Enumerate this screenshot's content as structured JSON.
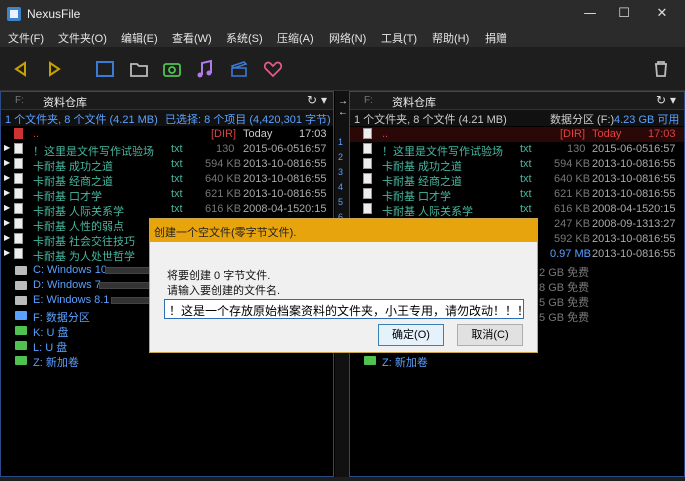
{
  "window": {
    "title": "NexusFile",
    "minimize": "—",
    "maximize": "☐",
    "close": "✕"
  },
  "menu": [
    "文件(F)",
    "文件夹(O)",
    "编辑(E)",
    "查看(W)",
    "系统(S)",
    "压缩(A)",
    "网络(N)",
    "工具(T)",
    "帮助(H)",
    "捐赠"
  ],
  "toolbar": {
    "icons": [
      "arrow-left-icon",
      "arrow-right-icon",
      "panel-icon",
      "folder-icon",
      "camera-icon",
      "music-icon",
      "box-icon",
      "heart-icon",
      "trash-icon"
    ],
    "colors": {
      "accent_yellow": "#c8a000",
      "blue": "#3a7ad8",
      "green": "#4fc24f",
      "purple": "#b07ae8",
      "pink": "#e05a8a"
    }
  },
  "left_panel": {
    "drive": "F:",
    "path": "资料仓库",
    "info_left": "1 个文件夹, 8 个文件 (4.21 MB)",
    "info_right": "已选择: 8 个项目 (4,420,301 字节)",
    "rows": [
      {
        "name": "..",
        "ext": "",
        "size": "[DIR]",
        "date": "Today",
        "time": "17:03",
        "parent": true
      },
      {
        "name": "！这里是文件写作试验场",
        "ext": "txt",
        "size": "130",
        "date": "2015-06-05",
        "time": "16:57"
      },
      {
        "name": "卡耐基 成功之道",
        "ext": "txt",
        "size": "594 KB",
        "date": "2013-10-08",
        "time": "16:55"
      },
      {
        "name": "卡耐基 经商之道",
        "ext": "txt",
        "size": "640 KB",
        "date": "2013-10-08",
        "time": "16:55"
      },
      {
        "name": "卡耐基 口才学",
        "ext": "txt",
        "size": "621 KB",
        "date": "2013-10-08",
        "time": "16:55"
      },
      {
        "name": "卡耐基 人际关系学",
        "ext": "txt",
        "size": "616 KB",
        "date": "2008-04-15",
        "time": "20:15"
      },
      {
        "name": "卡耐基 人性的弱点",
        "ext": "",
        "size": "",
        "date": "",
        "time": ""
      },
      {
        "name": "卡耐基 社会交往技巧",
        "ext": "",
        "size": "",
        "date": "",
        "time": ""
      },
      {
        "name": "卡耐基 为人处世哲学",
        "ext": "",
        "size": "",
        "date": "",
        "time": ""
      }
    ],
    "drives": [
      {
        "name": "C: Windows 10",
        "color": "#5aa0ff"
      },
      {
        "name": "D: Windows 7",
        "color": "#5aa0ff"
      },
      {
        "name": "E: Windows 8.1",
        "color": "#5aa0ff"
      },
      {
        "name": "F: 数据分区",
        "color": "#5aa0ff"
      },
      {
        "name": "K: U 盘",
        "color": "#5aa0ff"
      },
      {
        "name": "L: U 盘",
        "color": "#5aa0ff"
      },
      {
        "name": "Z: 新加卷",
        "color": "#5aa0ff"
      }
    ]
  },
  "right_panel": {
    "drive": "F:",
    "path": "资料仓库",
    "info_left": "1 个文件夹, 8 个文件 (4.21 MB)",
    "info_right_prefix": "数据分区 (F:)",
    "info_right_value": "4.23 GB 可用",
    "rows": [
      {
        "name": "..",
        "ext": "",
        "size": "[DIR]",
        "date": "Today",
        "time": "17:03",
        "parent": true
      },
      {
        "name": "！这里是文件写作试验场",
        "ext": "txt",
        "size": "130",
        "date": "2015-06-05",
        "time": "16:57"
      },
      {
        "name": "卡耐基 成功之道",
        "ext": "txt",
        "size": "594 KB",
        "date": "2013-10-08",
        "time": "16:55"
      },
      {
        "name": "卡耐基 经商之道",
        "ext": "txt",
        "size": "640 KB",
        "date": "2013-10-08",
        "time": "16:55"
      },
      {
        "name": "卡耐基 口才学",
        "ext": "txt",
        "size": "621 KB",
        "date": "2013-10-08",
        "time": "16:55"
      },
      {
        "name": "卡耐基 人际关系学",
        "ext": "txt",
        "size": "616 KB",
        "date": "2008-04-15",
        "time": "20:15"
      },
      {
        "name": "",
        "ext": "",
        "size": "247 KB",
        "date": "2008-09-13",
        "time": "13:27"
      },
      {
        "name": "",
        "ext": "",
        "size": "592 KB",
        "date": "2013-10-08",
        "time": "16:55"
      },
      {
        "name": "",
        "ext": "",
        "size": "",
        "date": "2013-10-08",
        "time": "16:55"
      }
    ],
    "free_labels": [
      ".2 GB 免费",
      ".8 GB 免费",
      ".5 GB 免费",
      ".5 GB 免费",
      "",
      "",
      ""
    ],
    "partial_size": "0.97 MB",
    "drive_z": "Z: 新加卷"
  },
  "mid_strip": {
    "numbers": [
      "1",
      "2",
      "3",
      "4",
      "5",
      "6"
    ]
  },
  "dialog": {
    "title": "创建一个空文件(零字节文件).",
    "line1": "将要创建 0 字节文件.",
    "line2": "请输入要创建的文件名.",
    "input_value": "！这是一个存放原始档案资料的文件夹，小王专用，请勿改动！！！",
    "ok": "确定(O)",
    "cancel": "取消(C)"
  }
}
